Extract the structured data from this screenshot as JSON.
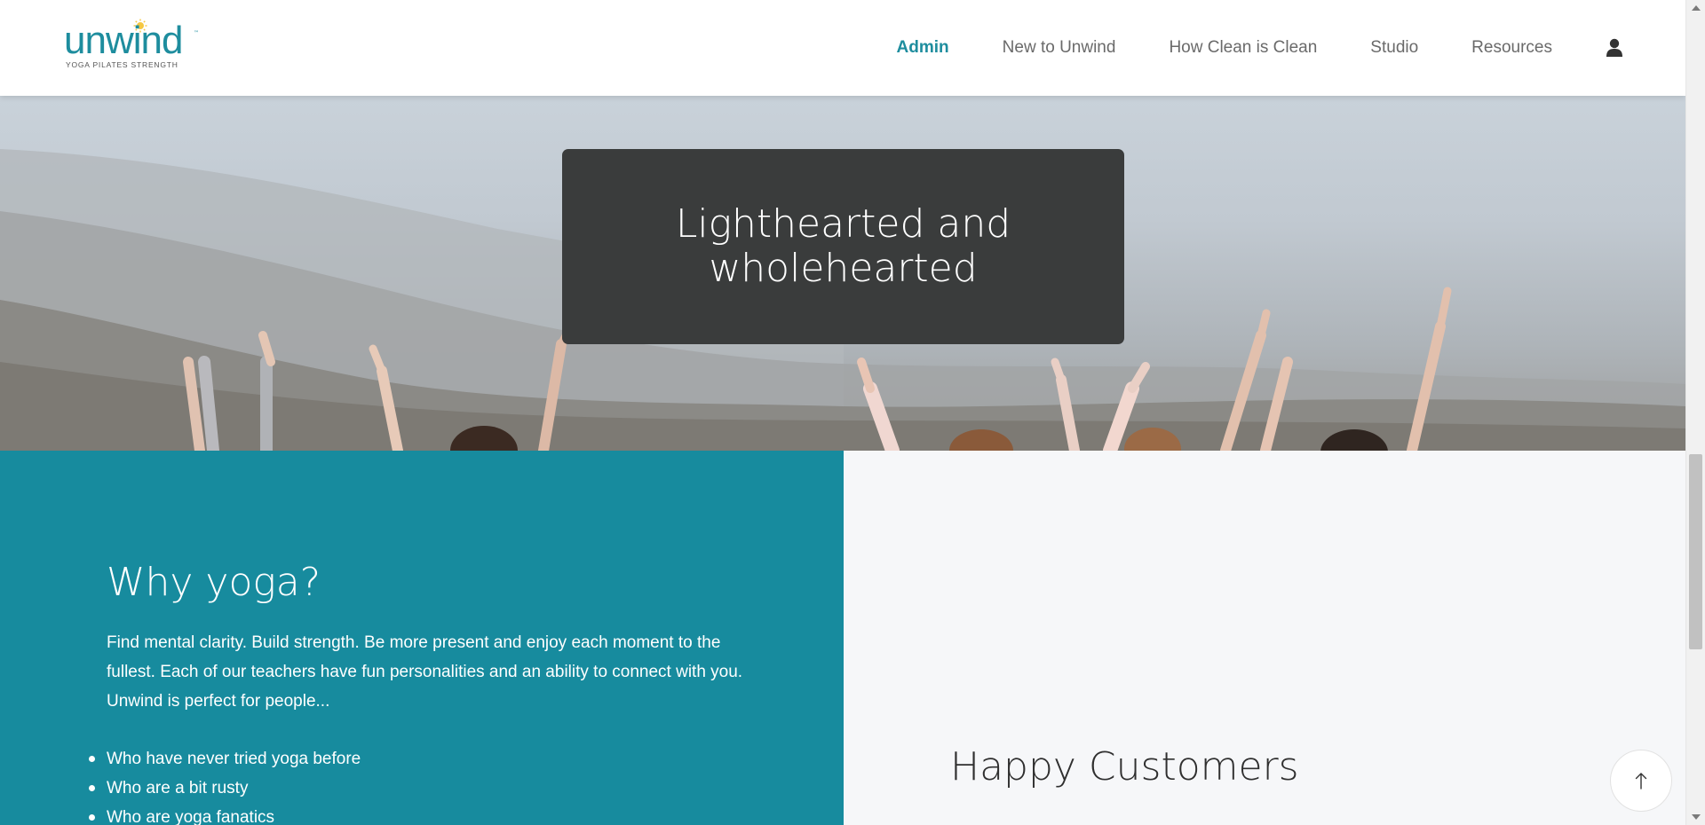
{
  "header": {
    "logo": {
      "word": "unwind",
      "tm": "™",
      "tagline": "YOGA  PILATES  STRENGTH"
    },
    "nav": [
      {
        "label": "Admin",
        "active": true
      },
      {
        "label": "New to Unwind",
        "active": false
      },
      {
        "label": "How Clean is Clean",
        "active": false
      },
      {
        "label": "Studio",
        "active": false
      },
      {
        "label": "Resources",
        "active": false
      }
    ],
    "user_icon": "user-icon"
  },
  "hero": {
    "title": "Lighthearted and wholehearted",
    "image": "people-raising-arms-on-misty-hillside"
  },
  "why": {
    "title": "Why yoga?",
    "body": "Find mental clarity. Build strength. Be more present and enjoy each moment to the fullest. Each of our teachers have fun personalities and an ability to connect with you. Unwind is perfect for people...",
    "list": [
      "Who have never tried yoga before",
      "Who are a bit rusty",
      "Who are yoga fanatics"
    ]
  },
  "customers": {
    "title": "Happy Customers"
  },
  "scroll_top_icon": "arrow-up-icon",
  "colors": {
    "brand": "#1e8d9e",
    "section_teal": "#178b9e",
    "hero_card": "#3a3c3c",
    "light_bg": "#f6f7f9"
  }
}
